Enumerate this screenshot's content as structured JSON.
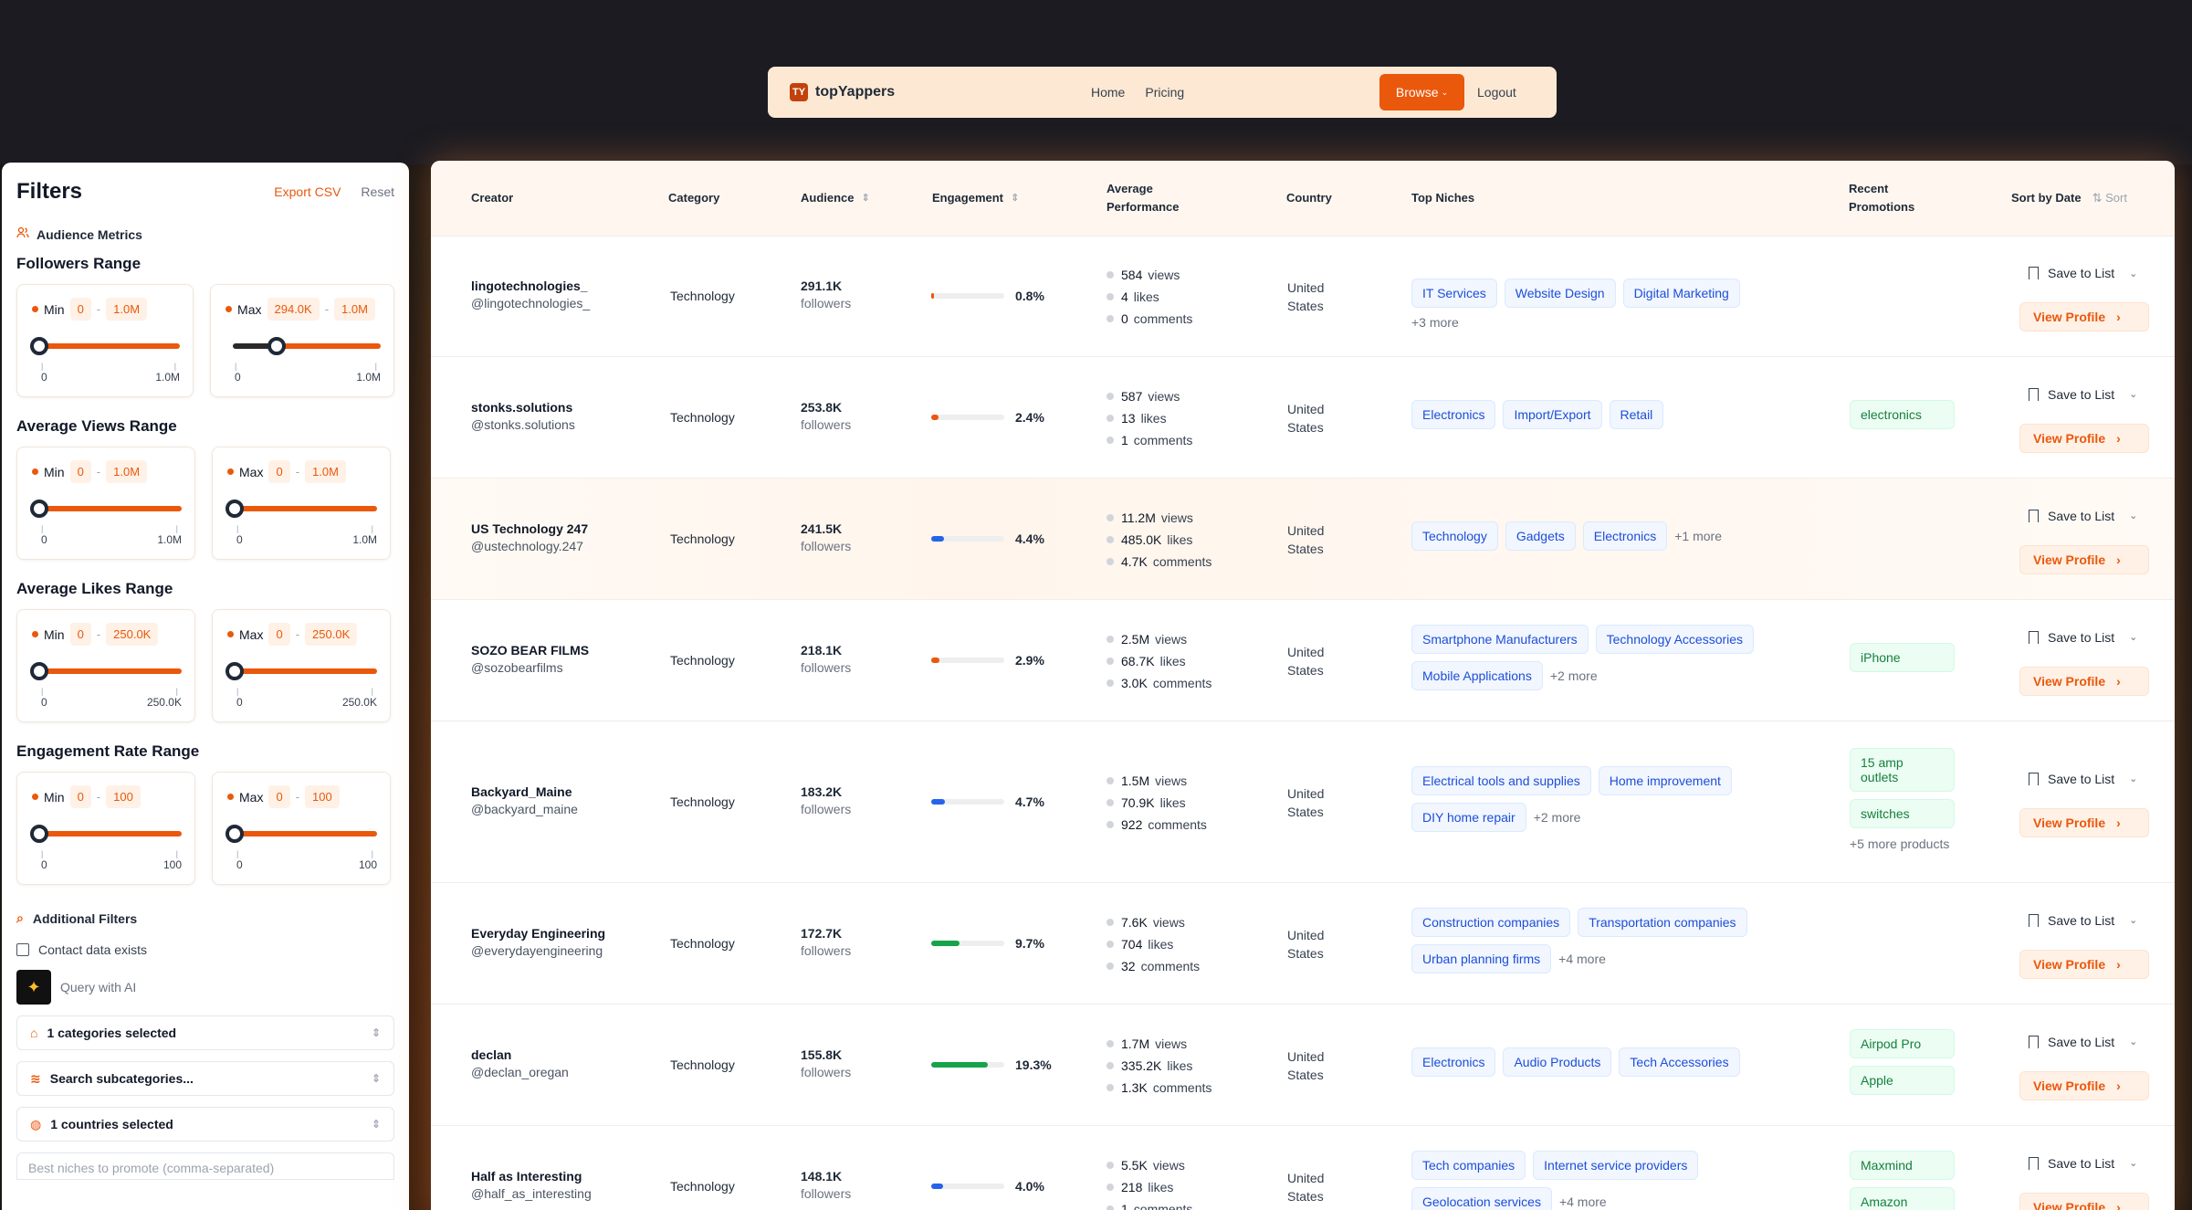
{
  "nav": {
    "logo_text": "TY",
    "brand": "topYappers",
    "links": [
      "Home",
      "Pricing"
    ],
    "browse": "Browse",
    "logout": "Logout"
  },
  "sidebar": {
    "title": "Filters",
    "export": "Export CSV",
    "reset": "Reset",
    "metrics_label": "Audience Metrics",
    "ranges": [
      {
        "title": "Followers Range",
        "min": {
          "label": "Min",
          "lo": "0",
          "hi": "1.0M",
          "tick_lo": "0",
          "tick_hi": "1.0M",
          "thumb": 0
        },
        "max": {
          "label": "Max",
          "lo": "294.0K",
          "hi": "1.0M",
          "tick_lo": "0",
          "tick_hi": "1.0M",
          "thumb": 0.294
        }
      },
      {
        "title": "Average Views Range",
        "min": {
          "label": "Min",
          "lo": "0",
          "hi": "1.0M",
          "tick_lo": "0",
          "tick_hi": "1.0M",
          "thumb": 0
        },
        "max": {
          "label": "Max",
          "lo": "0",
          "hi": "1.0M",
          "tick_lo": "0",
          "tick_hi": "1.0M",
          "thumb": 0
        }
      },
      {
        "title": "Average Likes Range",
        "min": {
          "label": "Min",
          "lo": "0",
          "hi": "250.0K",
          "tick_lo": "0",
          "tick_hi": "250.0K",
          "thumb": 0
        },
        "max": {
          "label": "Max",
          "lo": "0",
          "hi": "250.0K",
          "tick_lo": "0",
          "tick_hi": "250.0K",
          "thumb": 0
        }
      },
      {
        "title": "Engagement Rate Range",
        "min": {
          "label": "Min",
          "lo": "0",
          "hi": "100",
          "tick_lo": "0",
          "tick_hi": "100",
          "thumb": 0
        },
        "max": {
          "label": "Max",
          "lo": "0",
          "hi": "100",
          "tick_lo": "0",
          "tick_hi": "100",
          "thumb": 0
        }
      }
    ],
    "additional": "Additional Filters",
    "contact": "Contact data exists",
    "ai_placeholder": "Query with AI",
    "categories": "1 categories selected",
    "subcategories": "Search subcategories...",
    "countries": "1 countries selected",
    "niches_placeholder": "Best niches to promote (comma-separated)"
  },
  "table": {
    "headers": {
      "creator": "Creator",
      "category": "Category",
      "audience": "Audience",
      "engagement": "Engagement",
      "avg_perf_1": "Average",
      "avg_perf_2": "Performance",
      "country": "Country",
      "niches": "Top Niches",
      "promo_1": "Recent",
      "promo_2": "Promotions",
      "sort_date": "Sort by Date",
      "sort": "Sort"
    },
    "labels": {
      "followers": "followers",
      "views": "views",
      "likes": "likes",
      "comments": "comments",
      "save": "Save to List",
      "view": "View Profile",
      "country_1": "United",
      "country_2": "States"
    },
    "rows": [
      {
        "name": "lingotechnologies_",
        "handle": "@lingotechnologies_",
        "category": "Technology",
        "audience": "291.1K",
        "eng": "0.8%",
        "eng_val": 0.8,
        "eng_color": "#ea580c",
        "views": "584",
        "likes": "4",
        "comments": "0",
        "niches": [
          "IT Services",
          "Website Design",
          "Digital Marketing"
        ],
        "niche_more": "+3 more",
        "more_newline": true,
        "promos": [],
        "promo_more": ""
      },
      {
        "name": "stonks.solutions",
        "handle": "@stonks.solutions",
        "category": "Technology",
        "audience": "253.8K",
        "eng": "2.4%",
        "eng_val": 2.4,
        "eng_color": "#ea580c",
        "views": "587",
        "likes": "13",
        "comments": "1",
        "niches": [
          "Electronics",
          "Import/Export",
          "Retail"
        ],
        "niche_more": "",
        "more_newline": false,
        "promos": [
          "electronics"
        ],
        "promo_more": ""
      },
      {
        "name": "US Technology 247",
        "handle": "@ustechnology.247",
        "category": "Technology",
        "audience": "241.5K",
        "eng": "4.4%",
        "eng_val": 4.4,
        "eng_color": "#2563eb",
        "views": "11.2M",
        "likes": "485.0K",
        "comments": "4.7K",
        "niches": [
          "Technology",
          "Gadgets",
          "Electronics"
        ],
        "niche_more": "+1 more",
        "more_newline": false,
        "promos": [],
        "promo_more": ""
      },
      {
        "name": "SOZO BEAR FILMS",
        "handle": "@sozobearfilms",
        "category": "Technology",
        "audience": "218.1K",
        "eng": "2.9%",
        "eng_val": 2.9,
        "eng_color": "#ea580c",
        "views": "2.5M",
        "likes": "68.7K",
        "comments": "3.0K",
        "niches": [
          "Smartphone Manufacturers",
          "Technology Accessories",
          "Mobile Applications"
        ],
        "niche_more": "+2 more",
        "more_newline": false,
        "promos": [
          "iPhone"
        ],
        "promo_more": ""
      },
      {
        "name": "Backyard_Maine",
        "handle": "@backyard_maine",
        "category": "Technology",
        "audience": "183.2K",
        "eng": "4.7%",
        "eng_val": 4.7,
        "eng_color": "#2563eb",
        "views": "1.5M",
        "likes": "70.9K",
        "comments": "922",
        "niches": [
          "Electrical tools and supplies",
          "Home improvement",
          "DIY home repair"
        ],
        "niche_more": "+2 more",
        "more_newline": false,
        "promos": [
          "15 amp outlets",
          "switches"
        ],
        "promo_more": "+5 more products"
      },
      {
        "name": "Everyday Engineering",
        "handle": "@everydayengineering",
        "category": "Technology",
        "audience": "172.7K",
        "eng": "9.7%",
        "eng_val": 9.7,
        "eng_color": "#16a34a",
        "views": "7.6K",
        "likes": "704",
        "comments": "32",
        "niches": [
          "Construction companies",
          "Transportation companies",
          "Urban planning firms"
        ],
        "niche_more": "+4 more",
        "more_newline": false,
        "promos": [],
        "promo_more": ""
      },
      {
        "name": "declan",
        "handle": "@declan_oregan",
        "category": "Technology",
        "audience": "155.8K",
        "eng": "19.3%",
        "eng_val": 19.3,
        "eng_color": "#16a34a",
        "views": "1.7M",
        "likes": "335.2K",
        "comments": "1.3K",
        "niches": [
          "Electronics",
          "Audio Products",
          "Tech Accessories"
        ],
        "niche_more": "",
        "more_newline": false,
        "promos": [
          "Airpod Pro",
          "Apple"
        ],
        "promo_more": ""
      },
      {
        "name": "Half as Interesting",
        "handle": "@half_as_interesting",
        "category": "Technology",
        "audience": "148.1K",
        "eng": "4.0%",
        "eng_val": 4.0,
        "eng_color": "#2563eb",
        "views": "5.5K",
        "likes": "218",
        "comments": "1",
        "niches": [
          "Tech companies",
          "Internet service providers",
          "Geolocation services"
        ],
        "niche_more": "+4 more",
        "more_newline": false,
        "promos": [
          "Maxmind",
          "Amazon"
        ],
        "promo_more": ""
      }
    ]
  }
}
